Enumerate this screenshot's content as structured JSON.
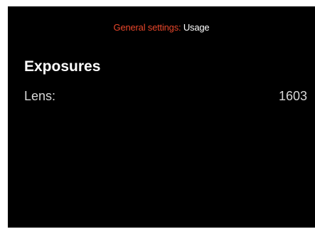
{
  "header": {
    "category": "General settings:",
    "page": "Usage",
    "category_color": "#e8462a",
    "page_color": "#ffffff"
  },
  "section": {
    "heading": "Exposures",
    "rows": [
      {
        "label": "Lens:",
        "value": "1603"
      }
    ]
  },
  "colors": {
    "screen_background": "#000000",
    "frame_background": "#ffffff"
  }
}
